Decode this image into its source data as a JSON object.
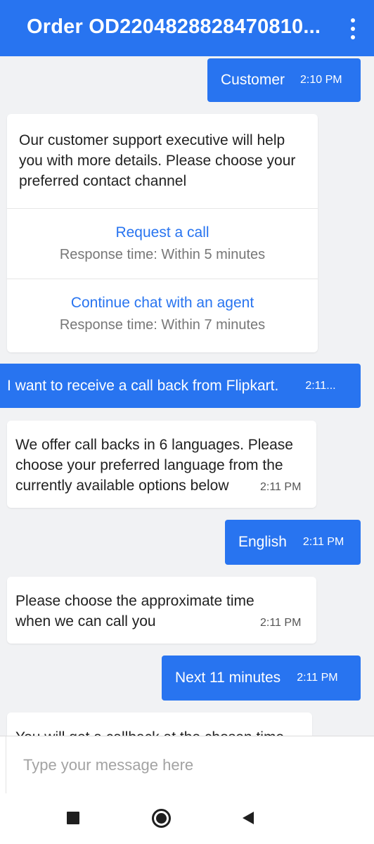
{
  "header": {
    "title": "Order OD2204828828470810..."
  },
  "messages": [
    {
      "direction": "out",
      "text": "Customer",
      "time": "2:10 PM"
    },
    {
      "direction": "in",
      "text": "Our customer support executive will help you with more details. Please choose your preferred contact channel",
      "options": [
        {
          "label": "Request a call",
          "sub": "Response time: Within 5 minutes"
        },
        {
          "label": "Continue chat with an agent",
          "sub": "Response time: Within 7 minutes"
        }
      ]
    },
    {
      "direction": "out",
      "text": "I want to receive a call back from Flipkart.",
      "time": "2:11..."
    },
    {
      "direction": "in",
      "text": "We offer call backs in 6 languages. Please choose your preferred language from the currently available options below",
      "time": "2:11 PM"
    },
    {
      "direction": "out",
      "text": "English",
      "time": "2:11 PM"
    },
    {
      "direction": "in",
      "text": "Please choose the approximate time when we can call you",
      "time": "2:11 PM"
    },
    {
      "direction": "out",
      "text": "Next 11 minutes",
      "time": "2:11 PM"
    },
    {
      "direction": "in",
      "text": "You will get a callback at the chosen time"
    }
  ],
  "composer": {
    "placeholder": "Type your message here"
  },
  "colors": {
    "accent": "#2874f0",
    "background": "#f1f2f4"
  },
  "icons": [
    "more-vertical-icon",
    "recents-icon",
    "home-icon",
    "back-icon"
  ]
}
